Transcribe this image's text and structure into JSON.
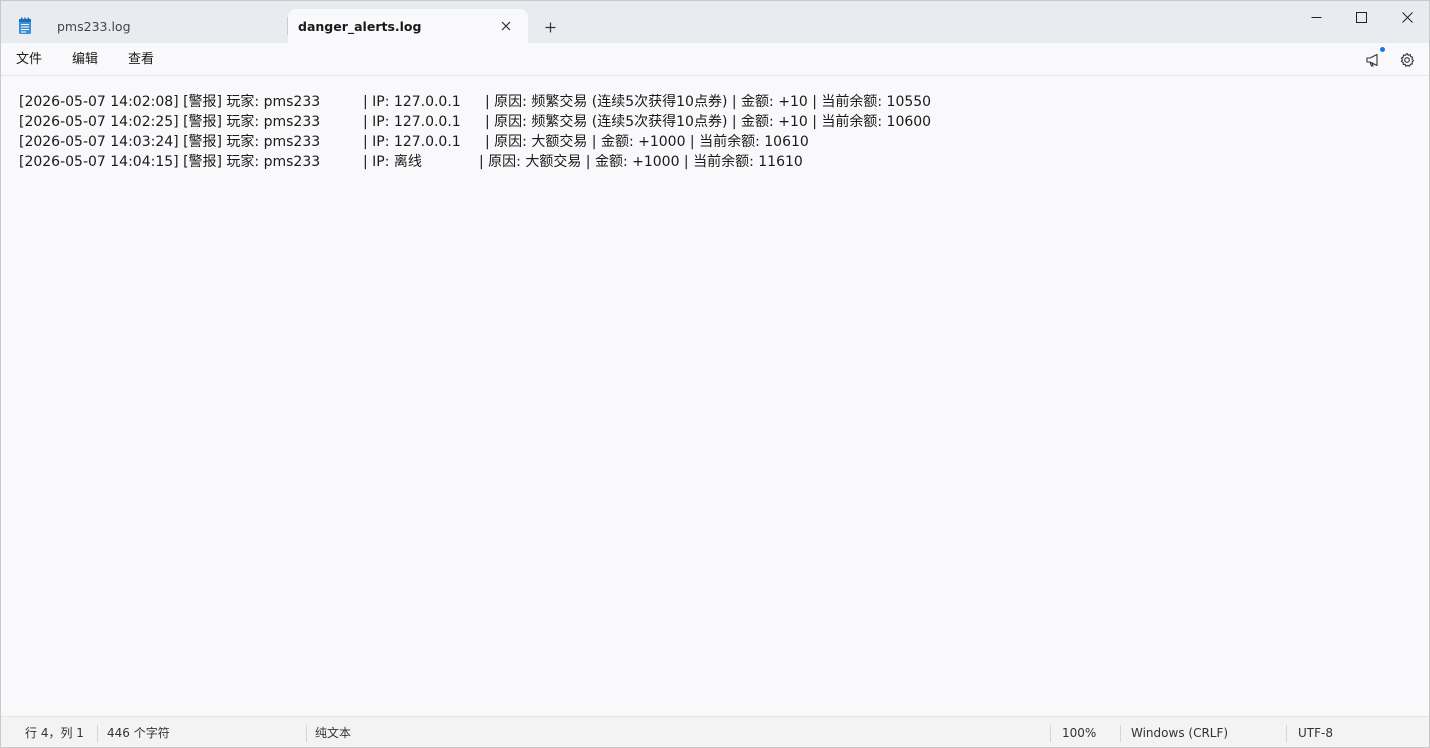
{
  "tabs": [
    {
      "label": "pms233.log",
      "active": false
    },
    {
      "label": "danger_alerts.log",
      "active": true
    }
  ],
  "menu": {
    "file": "文件",
    "edit": "编辑",
    "view": "查看"
  },
  "icons": {
    "app": "notepad-icon",
    "close_tab": "close-icon",
    "new_tab": "plus-icon",
    "announce": "megaphone-icon",
    "settings": "gear-icon"
  },
  "lines": [
    {
      "prefix": "[2026-05-07 14:02:08] [警报] 玩家: pms233",
      "ip": "| IP: 127.0.0.1",
      "rest": "| 原因: 频繁交易 (连续5次获得10点券) | 金额: +10 | 当前余额: 10550"
    },
    {
      "prefix": "[2026-05-07 14:02:25] [警报] 玩家: pms233",
      "ip": "| IP: 127.0.0.1",
      "rest": "| 原因: 频繁交易 (连续5次获得10点券) | 金额: +10 | 当前余额: 10600"
    },
    {
      "prefix": "[2026-05-07 14:03:24] [警报] 玩家: pms233",
      "ip": "| IP: 127.0.0.1",
      "rest": "| 原因: 大额交易 | 金额: +1000 | 当前余额: 10610"
    },
    {
      "prefix": "[2026-05-07 14:04:15] [警报] 玩家: pms233",
      "ip": "| IP: 离线",
      "rest": "| 原因: 大额交易 | 金额: +1000 | 当前余额: 11610"
    }
  ],
  "status": {
    "position": "行 4，列 1",
    "chars": "446 个字符",
    "format": "纯文本",
    "zoom": "100%",
    "line_ending": "Windows (CRLF)",
    "encoding": "UTF-8"
  },
  "colors": {
    "accent": "#1a73e8",
    "tabbar": "#e8ebf0",
    "editor_bg": "#f9f9fb"
  }
}
